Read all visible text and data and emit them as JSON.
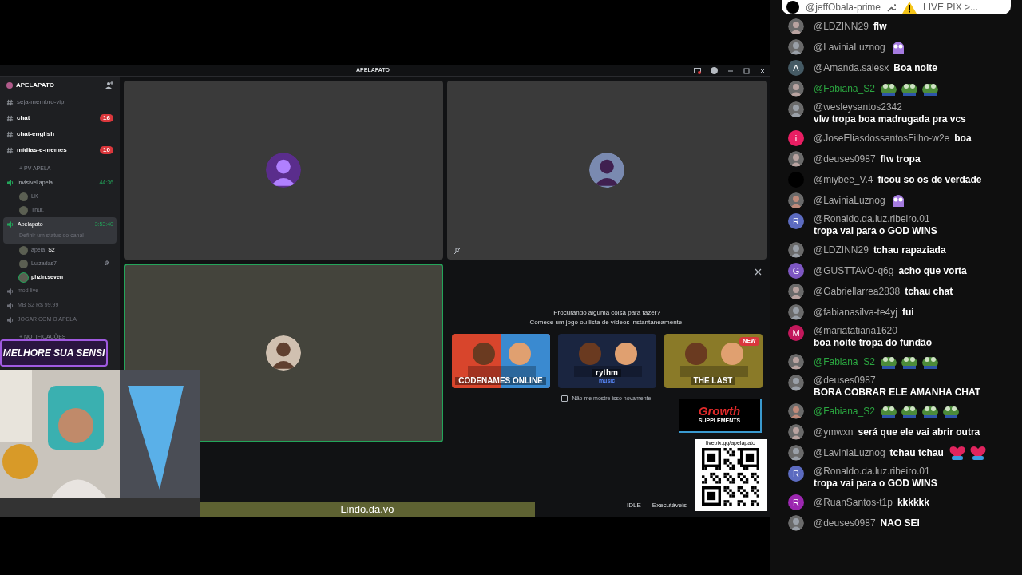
{
  "discord": {
    "title": "APELAPATO",
    "server_name": "APELAPATO",
    "sidebar": [
      {
        "kind": "text",
        "name": "seja-membro-vip",
        "unread": false
      },
      {
        "kind": "text",
        "name": "chat",
        "unread": true,
        "badge": "16"
      },
      {
        "kind": "text",
        "name": "chat-english",
        "unread": true
      },
      {
        "kind": "text",
        "name": "mídias-e-memes",
        "unread": true,
        "badge": "10"
      },
      {
        "kind": "category",
        "name": "+ PV APELA"
      },
      {
        "kind": "voice",
        "name": "invisível apela",
        "timer": "44:36",
        "active": true,
        "selected": false
      },
      {
        "kind": "member",
        "name": "LK",
        "speaking": false
      },
      {
        "kind": "member",
        "name": "Thur.",
        "speaking": false
      },
      {
        "kind": "voice",
        "name": "Apelapato",
        "timer": "3:53:40",
        "active": true,
        "selected": true,
        "status": "Definir um status do canal"
      },
      {
        "kind": "member",
        "name": "apela",
        "tag": "S2",
        "speaking": false
      },
      {
        "kind": "member",
        "name": "Luizadas7",
        "speaking": false,
        "muted": true
      },
      {
        "kind": "member",
        "name": "phzin.seven",
        "speaking": true
      },
      {
        "kind": "voice",
        "name": "mod live",
        "active": false,
        "selected": false
      },
      {
        "kind": "voice",
        "name": "MB S2 R$ 99,99",
        "active": false,
        "selected": false
      },
      {
        "kind": "voice",
        "name": "JOGAR COM O APELA",
        "active": false,
        "selected": false
      },
      {
        "kind": "category",
        "name": "+ NOTIFICAÇÕES"
      }
    ],
    "tiles": [
      {
        "speaking": false,
        "muted": false
      },
      {
        "speaking": false,
        "muted": true
      },
      {
        "speaking": true,
        "muted": false
      }
    ],
    "activity": {
      "prompt": "Procurando alguma coisa para fazer?",
      "subprompt": "Comece um jogo ou lista de vídeos instantaneamente.",
      "cards": [
        {
          "title": "CODENAMES ONLINE"
        },
        {
          "title": "rythm",
          "subtitle": "music"
        },
        {
          "title": "THE LAST",
          "badge": "NEW"
        }
      ],
      "checkbox": {
        "label": "Não me mostre isso novamente.",
        "checked": false
      }
    },
    "status": [
      "IDLE",
      "Executáveis"
    ]
  },
  "overlays": {
    "banner": "MELHORE SUA SENSI",
    "lyrics": "Lindo.da.vo",
    "qr_url": "livepix.gg/apelapato",
    "sponsor": "Growth",
    "sponsor_sub": "SUPPLEMENTS"
  },
  "chat": {
    "pinned": {
      "author": "@jeffObala-prime",
      "text": "LIVE PIX >..."
    },
    "messages": [
      {
        "author": "@LDZINN29",
        "text": "flw",
        "avatar": {
          "kind": "picture"
        },
        "member": false
      },
      {
        "author": "@LaviniaLuznog",
        "avatar": {
          "kind": "picture"
        },
        "member": false,
        "emotes": [
          {
            "kind": "purple"
          }
        ]
      },
      {
        "author": "@Amanda.salesx",
        "text": "Boa noite",
        "avatar": {
          "kind": "letter",
          "letter": "A",
          "color": "#455a64"
        },
        "member": false
      },
      {
        "author": "@Fabiana_S2",
        "avatar": {
          "kind": "picture"
        },
        "member": true,
        "emotes": [
          {
            "kind": "frog"
          },
          {
            "kind": "frog"
          },
          {
            "kind": "frog"
          }
        ]
      },
      {
        "author": "@wesleysantos2342",
        "text": "vlw tropa boa madrugada pra vcs",
        "avatar": {
          "kind": "picture"
        },
        "member": false
      },
      {
        "author": "@JoseEliasdossantosFilho-w2e",
        "text": "boa",
        "avatar": {
          "kind": "letter",
          "letter": "i",
          "color": "#e91e63"
        },
        "member": false
      },
      {
        "author": "@deuses0987",
        "text": "flw tropa",
        "avatar": {
          "kind": "picture"
        },
        "member": false
      },
      {
        "author": "@miybee_V.4",
        "text": "ficou so os de verdade",
        "avatar": {
          "kind": "letter",
          "color": "#000000"
        },
        "member": false
      },
      {
        "author": "@LaviniaLuznog",
        "avatar": {
          "kind": "picture"
        },
        "member": false,
        "emotes": [
          {
            "kind": "purple"
          }
        ]
      },
      {
        "author": "@Ronaldo.da.luz.ribeiro.01",
        "text": "tropa vai para o GOD WINS",
        "avatar": {
          "kind": "letter",
          "letter": "R",
          "color": "#5c6bc0"
        },
        "member": false
      },
      {
        "author": "@LDZINN29",
        "text": "tchau rapaziada",
        "avatar": {
          "kind": "picture"
        },
        "member": false
      },
      {
        "author": "@GUSTTAVO-q6g",
        "text": "acho que vorta",
        "avatar": {
          "kind": "letter",
          "letter": "G",
          "color": "#7e57c2"
        },
        "member": false
      },
      {
        "author": "@Gabriellarrea2838",
        "text": "tchau chat",
        "avatar": {
          "kind": "picture"
        },
        "member": false
      },
      {
        "author": "@fabianasilva-te4yj",
        "text": "fui",
        "avatar": {
          "kind": "picture"
        },
        "member": false
      },
      {
        "author": "@mariatatiana1620",
        "text": "boa noite tropa do fundão",
        "avatar": {
          "kind": "letter",
          "letter": "M",
          "color": "#c2185b"
        },
        "member": false
      },
      {
        "author": "@Fabiana_S2",
        "avatar": {
          "kind": "picture"
        },
        "member": true,
        "emotes": [
          {
            "kind": "frog"
          },
          {
            "kind": "frog"
          },
          {
            "kind": "frog"
          }
        ]
      },
      {
        "author": "@deuses0987",
        "text": "BORA COBRAR ELE AMANHA CHAT",
        "avatar": {
          "kind": "picture"
        },
        "member": false
      },
      {
        "author": "@Fabiana_S2",
        "avatar": {
          "kind": "picture"
        },
        "member": true,
        "emotes": [
          {
            "kind": "frog"
          },
          {
            "kind": "frog"
          },
          {
            "kind": "frog"
          },
          {
            "kind": "frog"
          }
        ]
      },
      {
        "author": "@ymwxn",
        "text": "será que ele vai abrir outra",
        "avatar": {
          "kind": "picture"
        },
        "member": false
      },
      {
        "author": "@LaviniaLuznog",
        "text": "tchau tchau",
        "avatar": {
          "kind": "picture"
        },
        "member": false,
        "emotes": [
          {
            "kind": "heart"
          },
          {
            "kind": "heart"
          }
        ]
      },
      {
        "author": "@Ronaldo.da.luz.ribeiro.01",
        "text": "tropa vai para o GOD WINS",
        "avatar": {
          "kind": "letter",
          "letter": "R",
          "color": "#5c6bc0"
        },
        "member": false
      },
      {
        "author": "@RuanSantos-t1p",
        "text": "kkkkkk",
        "avatar": {
          "kind": "letter",
          "letter": "R",
          "color": "#9c27b0"
        },
        "member": false
      },
      {
        "author": "@deuses0987",
        "text": "NAO SEI",
        "avatar": {
          "kind": "picture"
        },
        "member": false
      }
    ]
  }
}
